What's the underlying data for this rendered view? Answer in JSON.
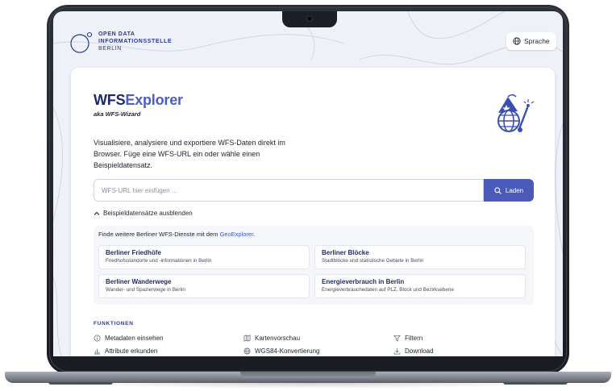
{
  "header": {
    "logo_line1": "OPEN DATA",
    "logo_line2": "INFORMATIONSSTELLE",
    "logo_line3": "BERLIN",
    "language_button": "Sprache"
  },
  "hero": {
    "title_part1": "WFS",
    "title_part2": "Explorer",
    "subtitle": "aka WFS-Wizard",
    "description": "Visualisiere, analysiere und exportiere WFS-Daten direkt im Browser. Füge eine WFS-URL ein oder wähle einen Beispieldatensatz."
  },
  "search": {
    "placeholder": "WFS-URL hier einfügen ...",
    "value": "",
    "load_button": "Laden"
  },
  "examples_toggle": "Beispieldatensätze ausblenden",
  "examples": {
    "intro_text": "Finde weitere Berliner WFS-Dienste mit dem ",
    "intro_link": "GeoExplorer",
    "intro_end": ".",
    "items": [
      {
        "title": "Berliner Friedhöfe",
        "description": "Friedhofsstandorte und -informationen in Berlin"
      },
      {
        "title": "Berliner Blöcke",
        "description": "Stadtblöcke und statistische Gebiete in Berlin"
      },
      {
        "title": "Berliner Wanderwege",
        "description": "Wander- und Spazierwege in Berlin"
      },
      {
        "title": "Energieverbrauch in Berlin",
        "description": "Energieverbrauchedaten auf PLZ, Block und Bezirksebene"
      }
    ]
  },
  "functions": {
    "heading": "FUNKTIONEN",
    "items": [
      {
        "label": "Metadaten einsehen",
        "icon": "info-icon"
      },
      {
        "label": "Kartenvorschau",
        "icon": "map-icon"
      },
      {
        "label": "Filtern",
        "icon": "filter-icon"
      },
      {
        "label": "Attribute erkunden",
        "icon": "bar-chart-icon"
      },
      {
        "label": "WGS84-Konvertierung",
        "icon": "globe-icon"
      },
      {
        "label": "Download",
        "icon": "download-icon"
      }
    ]
  },
  "colors": {
    "brand_dark": "#1c2a6b",
    "brand_accent": "#4a5ec0",
    "button": "#4a5ab8"
  }
}
